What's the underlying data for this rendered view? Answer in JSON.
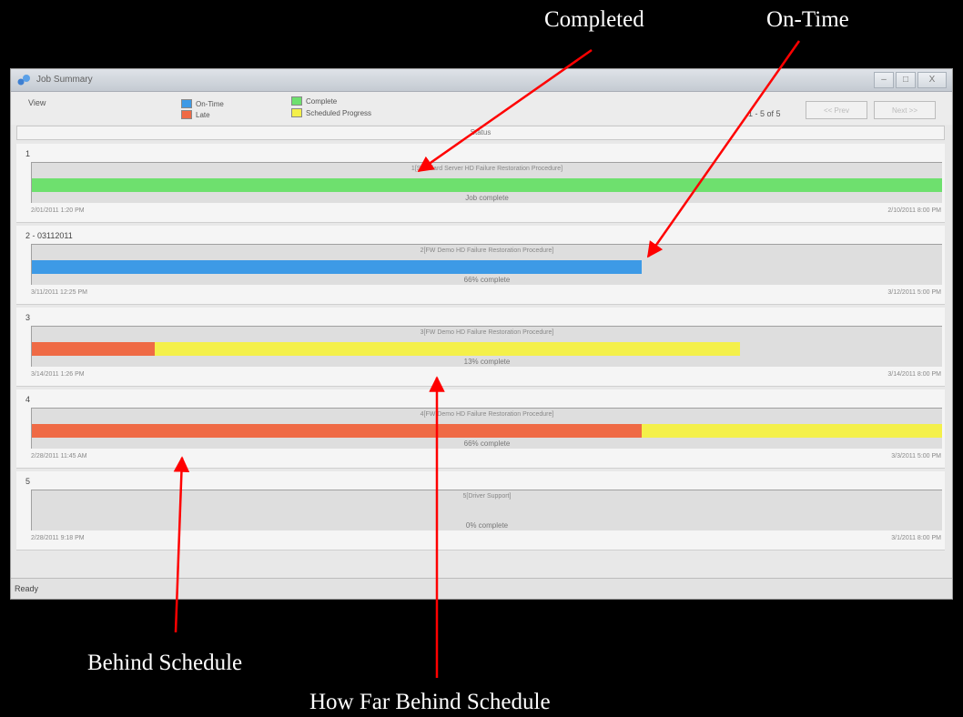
{
  "annotations": {
    "completed": "Completed",
    "on_time": "On-Time",
    "behind_schedule": "Behind Schedule",
    "how_far_behind": "How Far Behind Schedule"
  },
  "window": {
    "title": "Job Summary",
    "minimize": "–",
    "maximize": "□",
    "close": "X"
  },
  "toolbar": {
    "view_label": "View",
    "legend": [
      {
        "label": "On-Time",
        "color": "#3d9ae6"
      },
      {
        "label": "Late",
        "color": "#ef6a45"
      },
      {
        "label": "Complete",
        "color": "#6ee06e"
      },
      {
        "label": "Scheduled Progress",
        "color": "#f4f04a"
      }
    ],
    "page_indicator": "1 - 5 of 5",
    "prev_button": "<< Prev",
    "next_button": "Next >>"
  },
  "status_header": "Status",
  "colors": {
    "on_time": "#3d9ae6",
    "late": "#ef6a45",
    "complete": "#6ee06e",
    "scheduled": "#f4f04a"
  },
  "jobs": [
    {
      "number": "1",
      "procedure": "1[Standard Server HD Failure Restoration Procedure]",
      "status_text": "Job complete",
      "start": "2/01/2011 1:20 PM",
      "end": "2/10/2011 8:00 PM",
      "actual_progress": 1.0,
      "scheduled_progress": null,
      "state": "complete"
    },
    {
      "number": "2 - 03112011",
      "procedure": "2[FW Demo HD Failure Restoration Procedure]",
      "status_text": "66% complete",
      "start": "3/11/2011 12:25 PM",
      "end": "3/12/2011 5:00 PM",
      "actual_progress": 0.67,
      "scheduled_progress": null,
      "state": "on_time"
    },
    {
      "number": "3",
      "procedure": "3[FW Demo HD Failure Restoration Procedure]",
      "status_text": "13% complete",
      "start": "3/14/2011 1:26 PM",
      "end": "3/14/2011 8:00 PM",
      "actual_progress": 0.135,
      "scheduled_progress": 0.778,
      "state": "late"
    },
    {
      "number": "4",
      "procedure": "4[FW Demo HD Failure Restoration Procedure]",
      "status_text": "66% complete",
      "start": "2/28/2011 11:45 AM",
      "end": "3/3/2011 5:00 PM",
      "actual_progress": 0.67,
      "scheduled_progress": 1.0,
      "state": "late"
    },
    {
      "number": "5",
      "procedure": "5[Driver Support]",
      "status_text": "0% complete",
      "start": "2/28/2011 9:18 PM",
      "end": "3/1/2011 8:00 PM",
      "actual_progress": 0,
      "scheduled_progress": null,
      "state": "on_time"
    }
  ],
  "statusbar": "Ready"
}
